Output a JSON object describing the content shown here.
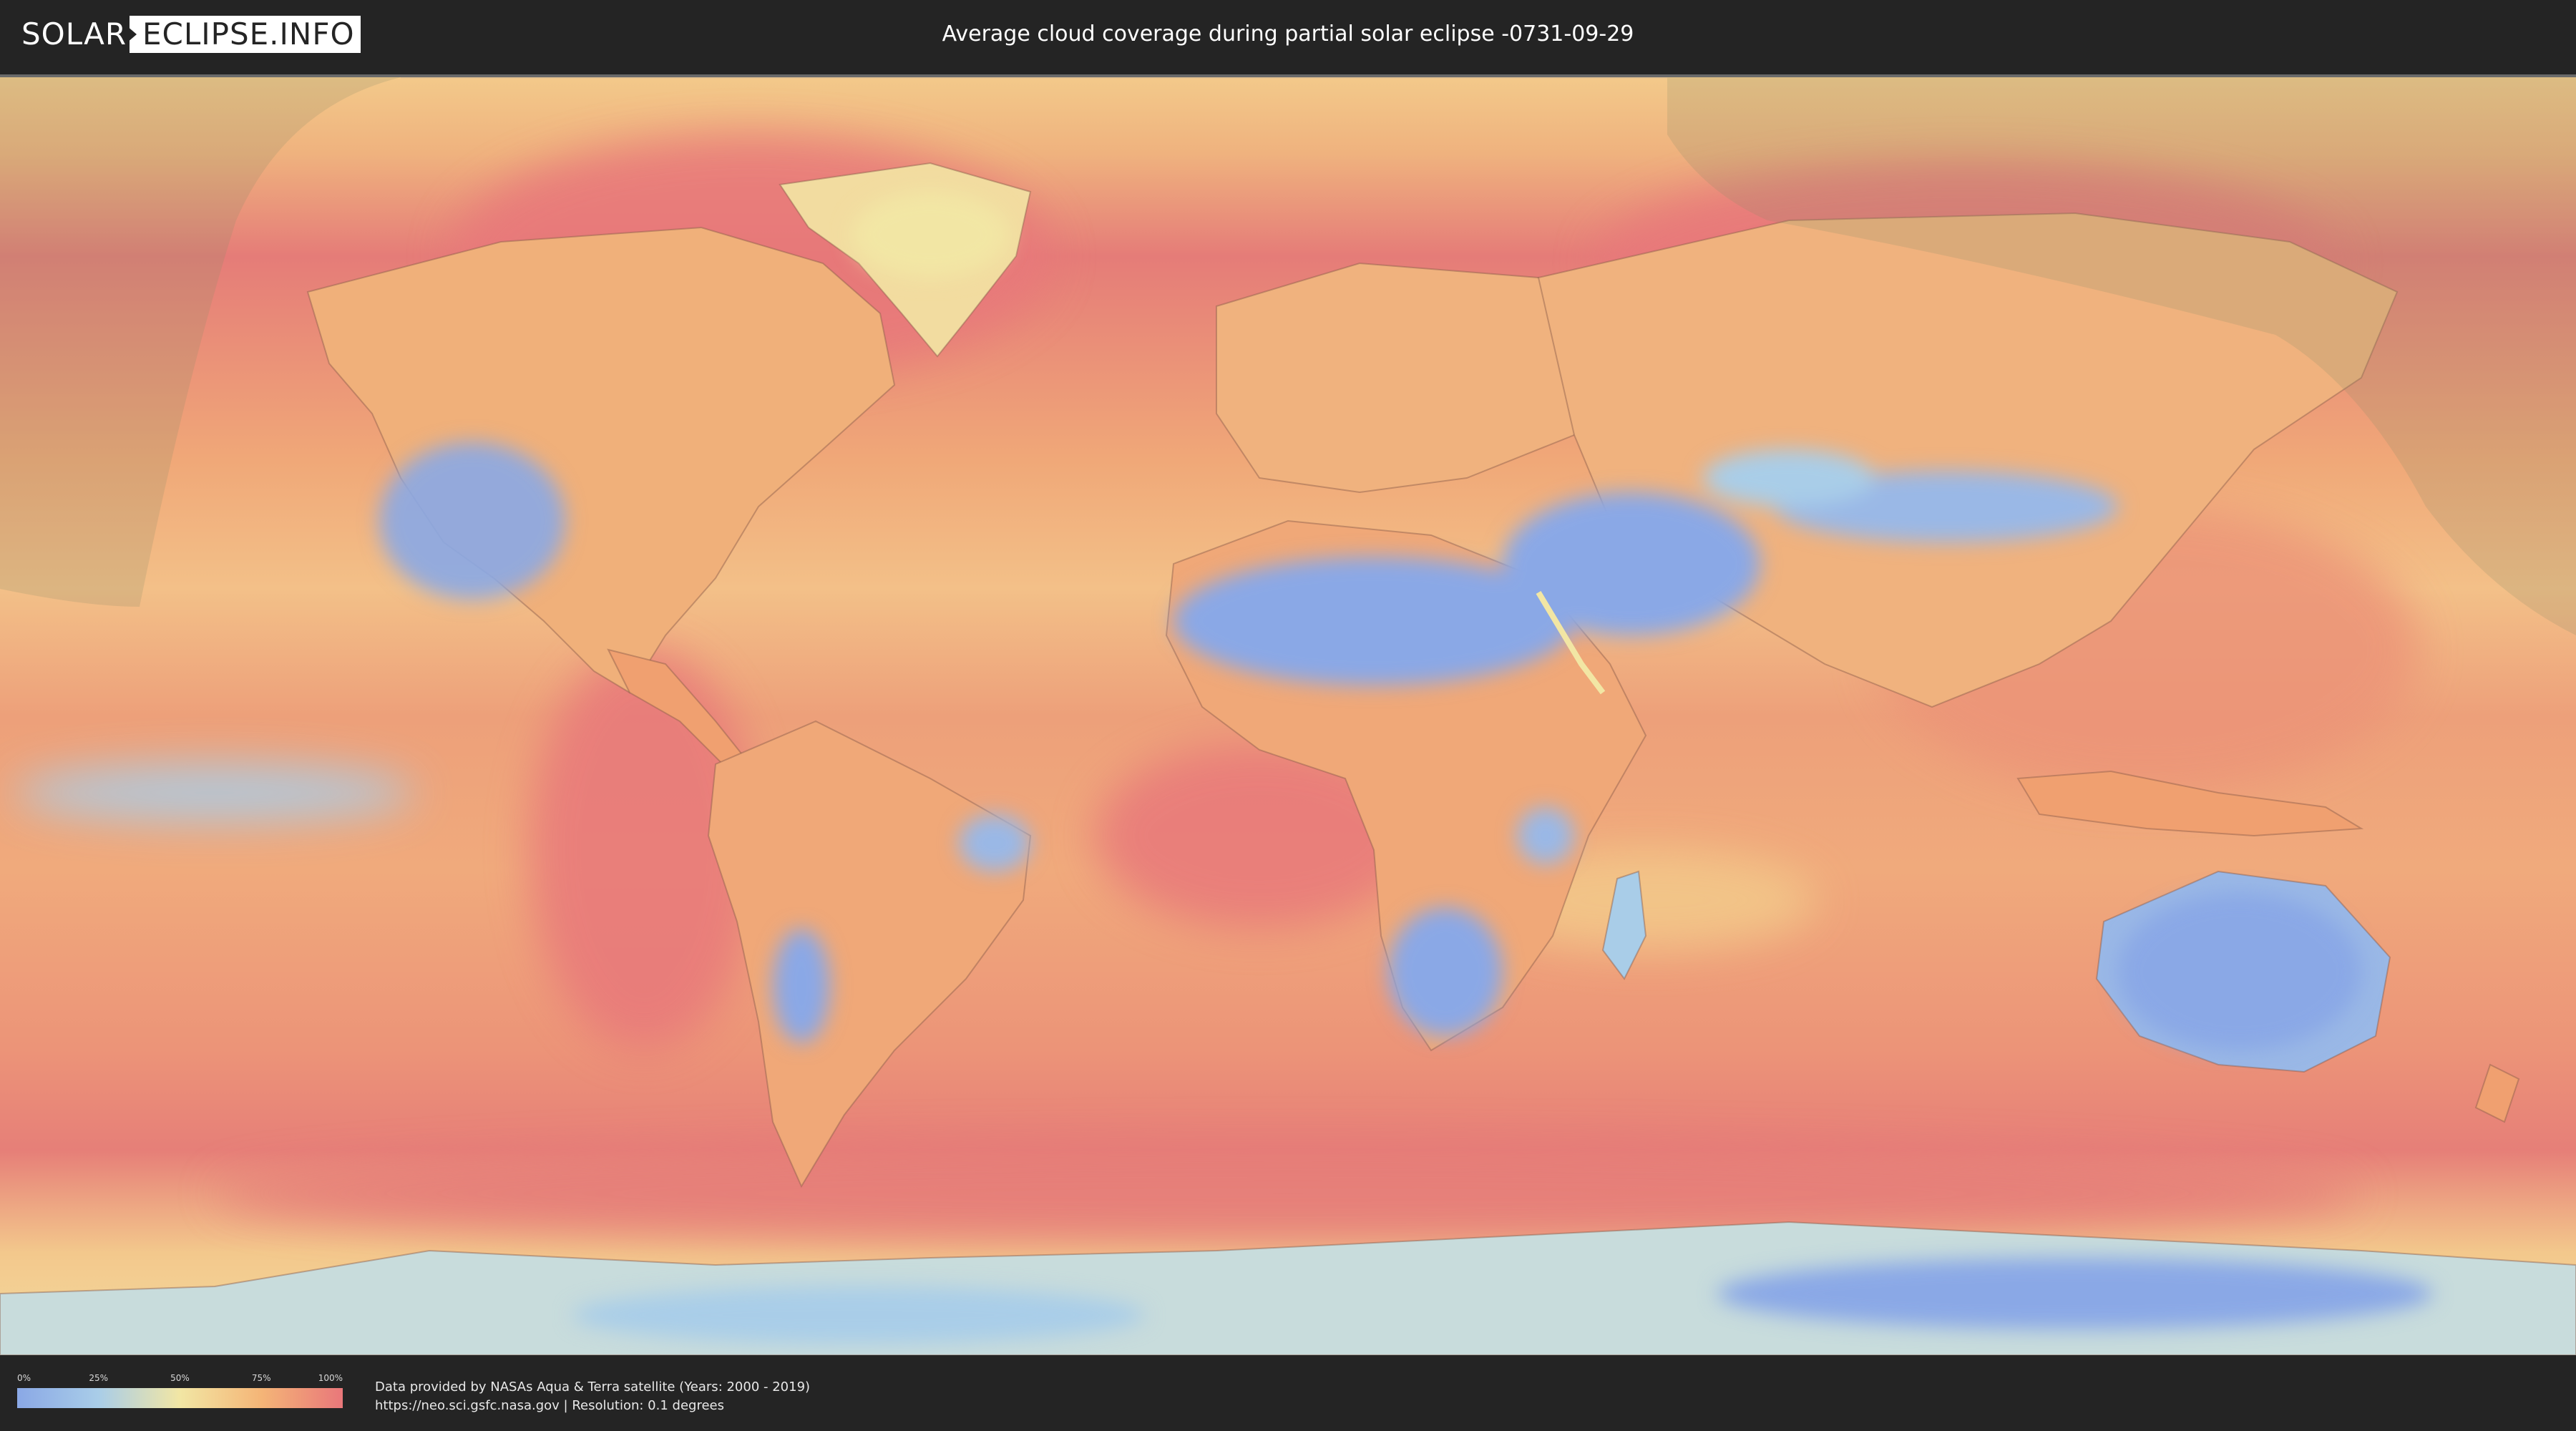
{
  "header": {
    "logo_part1": "SOLAR",
    "logo_part2": "ECLIPSE.INFO",
    "title": "Average cloud coverage during partial solar eclipse -0731-09-29"
  },
  "legend": {
    "ticks": [
      "0%",
      "25%",
      "50%",
      "75%",
      "100%"
    ],
    "colors": [
      "#8aa8e6",
      "#a9cde8",
      "#f2e6a4",
      "#f4b577",
      "#e9777a"
    ]
  },
  "footer": {
    "credit_line1": "Data provided by NASAs Aqua & Terra satellite (Years: 2000 - 2019)",
    "credit_line2": "https://neo.sci.gsfc.nasa.gov | Resolution: 0.1 degrees"
  },
  "map": {
    "ocean_color": "#f0a070",
    "cloudy_color": "#e8787a",
    "clear_color": "#8aa8e6",
    "shade_color": "#8c8c6a"
  }
}
